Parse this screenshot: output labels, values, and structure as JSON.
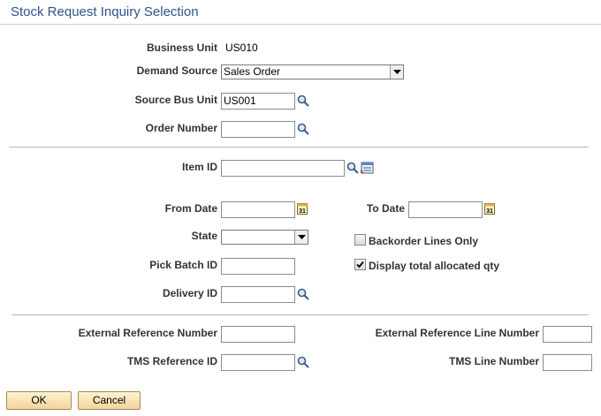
{
  "page": {
    "title": "Stock Request Inquiry Selection"
  },
  "fields": {
    "business_unit": {
      "label": "Business Unit",
      "value": "US010"
    },
    "demand_source": {
      "label": "Demand Source",
      "value": "Sales Order"
    },
    "source_bus_unit": {
      "label": "Source Bus Unit",
      "value": "US001"
    },
    "order_number": {
      "label": "Order Number",
      "value": ""
    },
    "item_id": {
      "label": "Item ID",
      "value": ""
    },
    "from_date": {
      "label": "From Date",
      "value": ""
    },
    "to_date": {
      "label": "To Date",
      "value": ""
    },
    "state": {
      "label": "State",
      "value": ""
    },
    "backorder_lines_only": {
      "label": "Backorder Lines Only",
      "checked": false
    },
    "pick_batch_id": {
      "label": "Pick Batch ID",
      "value": ""
    },
    "display_total_allocated_qty": {
      "label": "Display total allocated qty",
      "checked": true
    },
    "delivery_id": {
      "label": "Delivery ID",
      "value": ""
    },
    "external_reference_number": {
      "label": "External Reference Number",
      "value": ""
    },
    "external_reference_line_number": {
      "label": "External Reference Line Number",
      "value": ""
    },
    "tms_reference_id": {
      "label": "TMS Reference ID",
      "value": ""
    },
    "tms_line_number": {
      "label": "TMS Line Number",
      "value": ""
    }
  },
  "buttons": {
    "ok": "OK",
    "cancel": "Cancel"
  },
  "icons": {
    "lookup": "magnifier-lookup-icon",
    "calendar": "calendar-icon",
    "item_search": "item-search-icon",
    "dropdown": "chevron-down-icon"
  },
  "calendar_icon_text": "31",
  "colors": {
    "title": "#30538a",
    "button_top": "#fff3d1",
    "button_bottom": "#f2d49b",
    "button_border": "#a8895b"
  }
}
